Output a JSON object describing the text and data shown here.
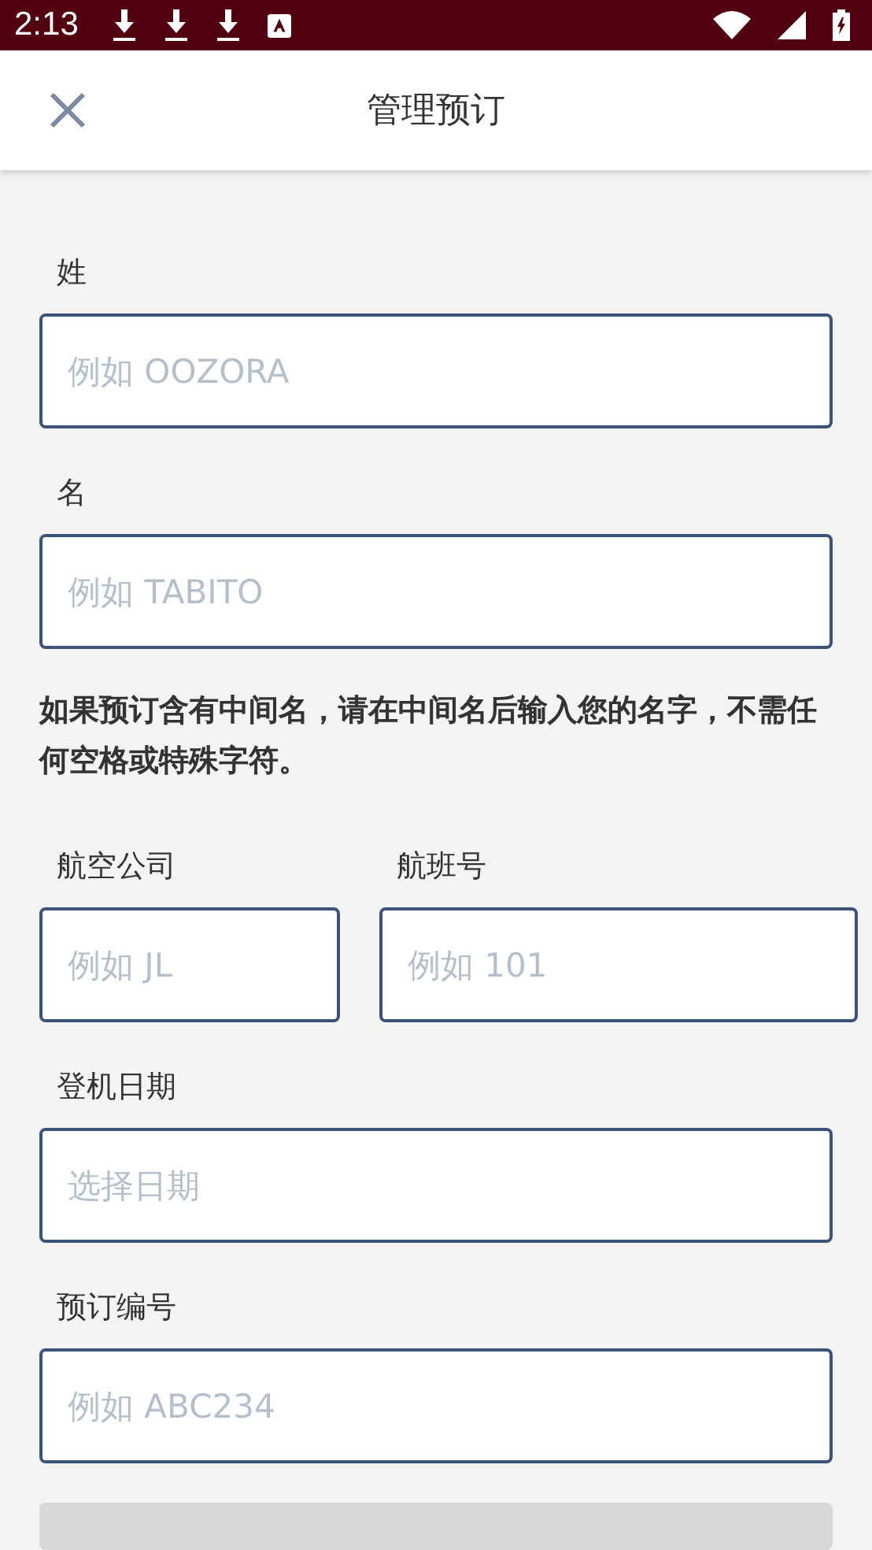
{
  "status_bar": {
    "time": "2:13"
  },
  "header": {
    "title": "管理预订"
  },
  "form": [
    {
      "kind": "field",
      "label": "姓",
      "placeholder": "例如 OOZORA"
    },
    {
      "kind": "field",
      "label": "名",
      "placeholder": "例如 TABITO"
    },
    {
      "kind": "note",
      "text": "如果预订含有中间名，请在中间名后输入您的名字，不需任何空格或特殊字符。"
    },
    {
      "kind": "pair",
      "fields": [
        {
          "label": "航空公司",
          "placeholder": "例如 JL"
        },
        {
          "label": "航班号",
          "placeholder": "例如 101"
        }
      ]
    },
    {
      "kind": "date",
      "label": "登机日期",
      "placeholder": "选择日期"
    },
    {
      "kind": "field",
      "label": "预订编号",
      "placeholder": "例如 ABC234"
    }
  ]
}
